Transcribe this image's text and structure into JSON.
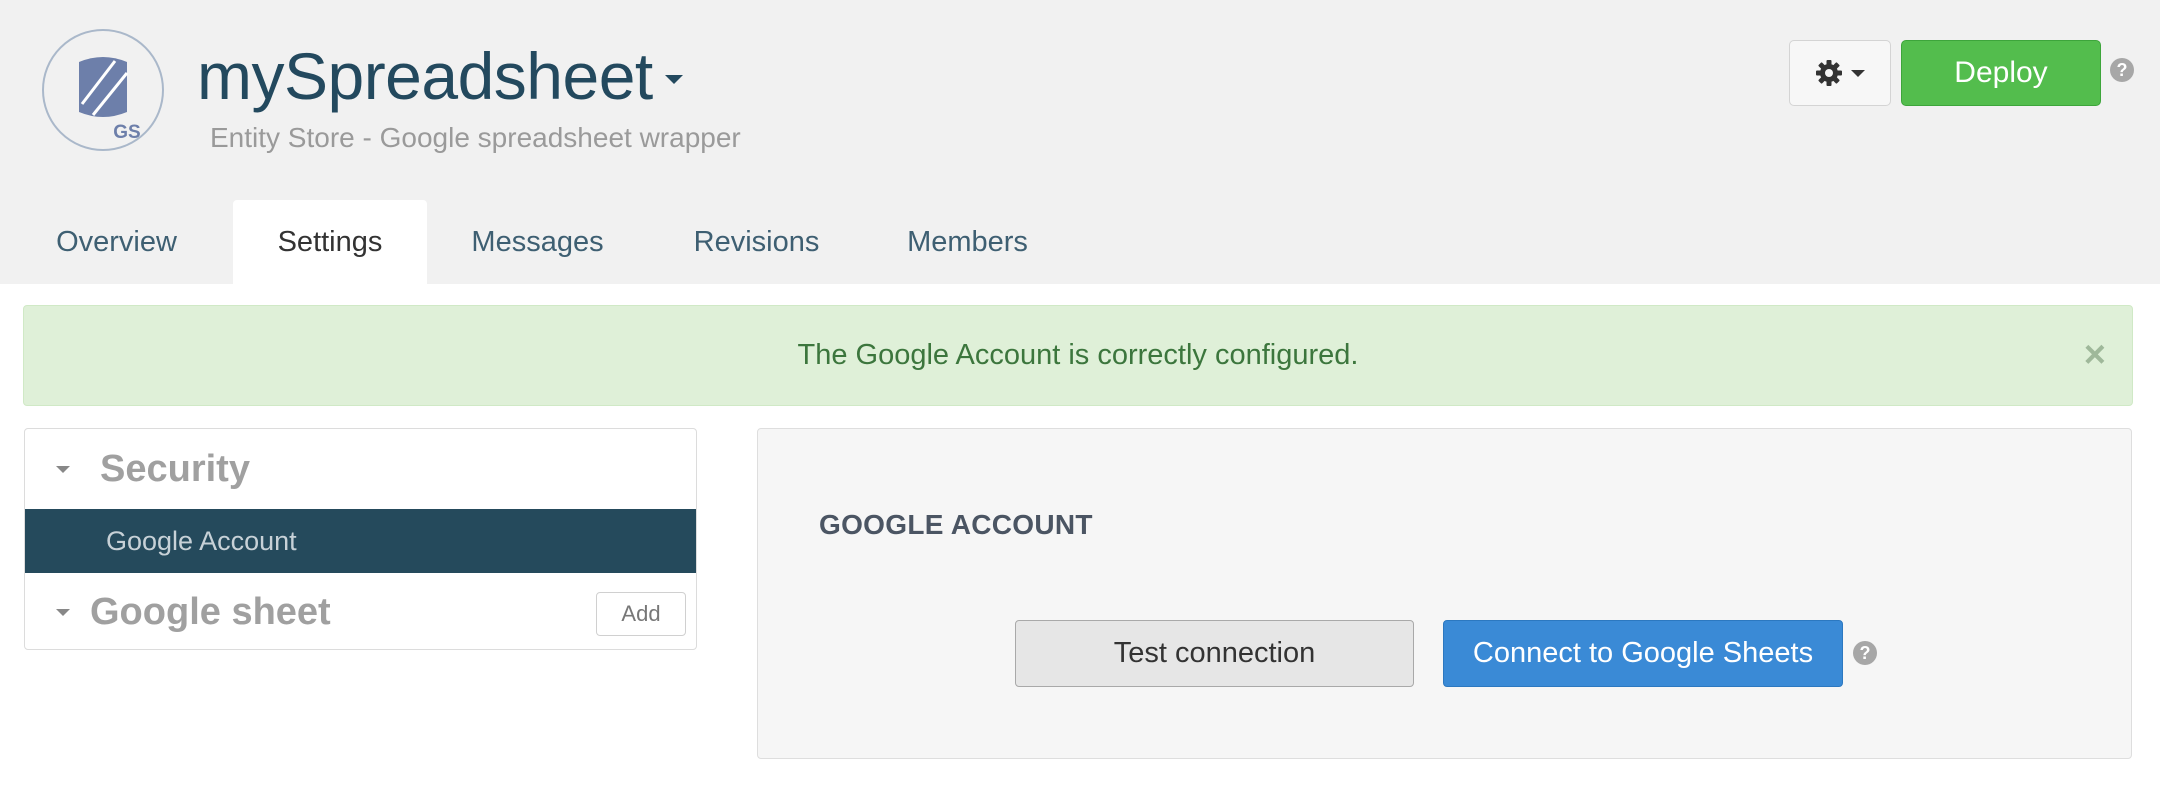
{
  "header": {
    "logo_text": "GS",
    "title": "mySpreadsheet",
    "subtitle": "Entity Store - Google spreadsheet wrapper",
    "deploy_label": "Deploy",
    "help_glyph": "?"
  },
  "tabs": [
    {
      "label": "Overview"
    },
    {
      "label": "Settings",
      "active": true
    },
    {
      "label": "Messages"
    },
    {
      "label": "Revisions"
    },
    {
      "label": "Members"
    }
  ],
  "alert": {
    "message": "The Google Account is correctly configured.",
    "close_glyph": "×"
  },
  "sidebar": {
    "security_title": "Security",
    "items": [
      {
        "label": "Google Account",
        "selected": true
      }
    ],
    "sheet_title": "Google sheet",
    "add_label": "Add"
  },
  "panel": {
    "title": "GOOGLE ACCOUNT",
    "test_label": "Test connection",
    "connect_label": "Connect to Google Sheets",
    "help_glyph": "?"
  },
  "icons": {
    "logo": "database-icon",
    "settings": "gear-icon",
    "help": "help-icon",
    "collapse": "caret-down-icon",
    "close": "close-icon"
  },
  "colors": {
    "brand_dark": "#23495e",
    "deploy_green": "#53bd4d",
    "primary_blue": "#3a8ad6",
    "success_bg": "#dff0d8",
    "success_text": "#3c763d",
    "selected_bg": "#254a5c"
  }
}
